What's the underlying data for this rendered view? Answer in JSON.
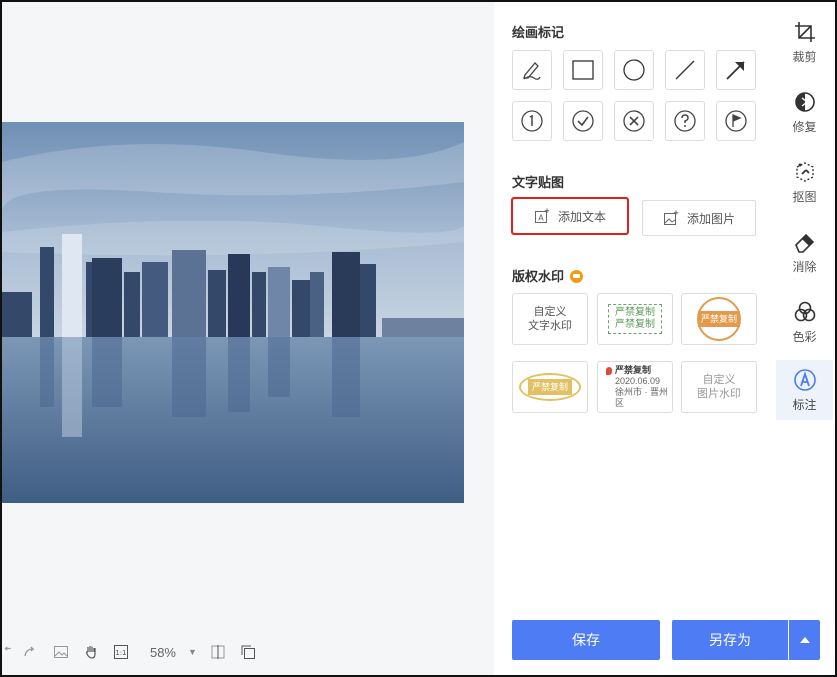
{
  "drawing_section": {
    "title": "绘画标记",
    "tools": [
      {
        "icon": "pen-icon"
      },
      {
        "icon": "rectangle-icon"
      },
      {
        "icon": "circle-icon"
      },
      {
        "icon": "line-icon"
      },
      {
        "icon": "arrow-icon"
      },
      {
        "icon": "number-1-icon"
      },
      {
        "icon": "check-circle-icon"
      },
      {
        "icon": "x-circle-icon"
      },
      {
        "icon": "question-circle-icon"
      },
      {
        "icon": "flag-circle-icon"
      }
    ]
  },
  "text_section": {
    "title": "文字贴图",
    "add_text_label": "添加文本",
    "add_image_label": "添加图片"
  },
  "watermark_section": {
    "title": "版权水印",
    "custom_text": [
      "自定义",
      "文字水印"
    ],
    "stamp_green": [
      "严禁复制",
      "严禁复制"
    ],
    "stamp_orange": "严禁复制",
    "stamp_gold": "严禁复制",
    "location_stamp": [
      "严禁复制",
      "2020.06.09",
      "徐州市 · 晋州区"
    ],
    "custom_image": [
      "自定义",
      "图片水印"
    ]
  },
  "rail": {
    "items": [
      {
        "label": "裁剪",
        "icon": "crop-icon"
      },
      {
        "label": "修复",
        "icon": "repair-icon"
      },
      {
        "label": "抠图",
        "icon": "cutout-icon"
      },
      {
        "label": "消除",
        "icon": "eraser-icon"
      },
      {
        "label": "色彩",
        "icon": "color-icon"
      },
      {
        "label": "标注",
        "icon": "annotate-icon"
      }
    ]
  },
  "toolbar": {
    "zoom": "58%"
  },
  "actions": {
    "save_label": "保存",
    "save_as_label": "另存为"
  },
  "colors": {
    "accent": "#4d7cf4",
    "highlight": "#e02020",
    "vip": "#f39c12"
  }
}
